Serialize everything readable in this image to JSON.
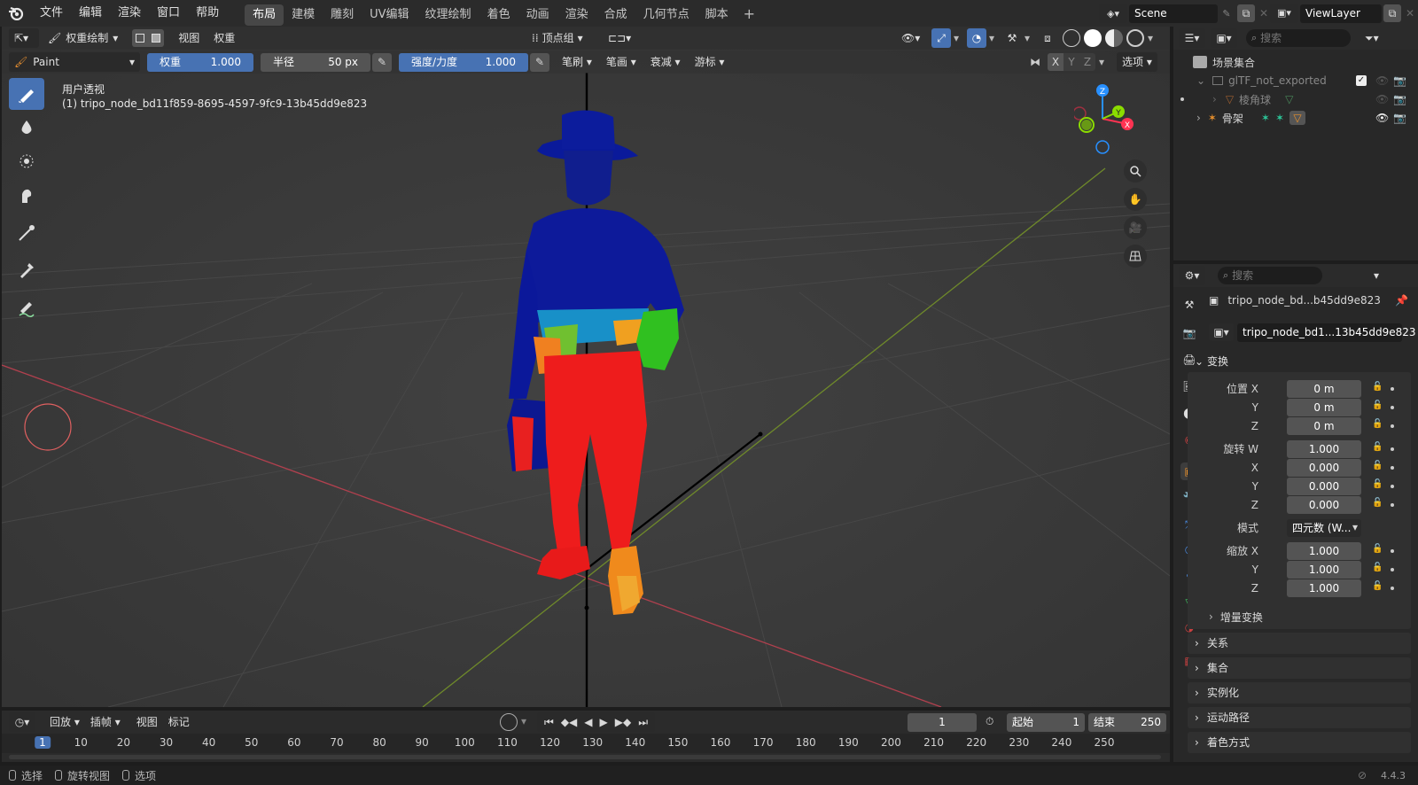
{
  "menu": {
    "items": [
      "文件",
      "编辑",
      "渲染",
      "窗口",
      "帮助"
    ]
  },
  "workspaces": {
    "tabs": [
      "布局",
      "建模",
      "雕刻",
      "UV编辑",
      "纹理绘制",
      "着色",
      "动画",
      "渲染",
      "合成",
      "几何节点",
      "脚本"
    ],
    "active": 0
  },
  "scene": {
    "name": "Scene",
    "view_layer": "ViewLayer"
  },
  "viewport_header": {
    "mode": "权重绘制",
    "view": "视图",
    "weights": "权重",
    "vertex_group": "顶点组"
  },
  "tool_settings": {
    "brush": "Paint",
    "weight_label": "权重",
    "weight_value": "1.000",
    "radius_label": "半径",
    "radius_value": "50 px",
    "strength_label": "强度/力度",
    "strength_value": "1.000",
    "brush_menu": "笔刷",
    "stroke_menu": "笔画",
    "falloff_menu": "衰减",
    "cursor_menu": "游标",
    "mirror": {
      "x": "X",
      "y": "Y",
      "z": "Z"
    },
    "options": "选项"
  },
  "overlay_text": {
    "view_name": "用户透视",
    "object_name": "(1) tripo_node_bd11f859-8695-4597-9fc9-13b45dd9e823"
  },
  "gizmo": {
    "x": "X",
    "y": "Y",
    "z": "Z"
  },
  "outliner": {
    "search_placeholder": "搜索",
    "root": "场景集合",
    "items": [
      {
        "name": "glTF_not_exported",
        "level": 1
      },
      {
        "name": "棱角球",
        "level": 2
      },
      {
        "name": "骨架",
        "level": 1
      }
    ]
  },
  "properties": {
    "search_placeholder": "搜索",
    "object_short": "tripo_node_bd...b45dd9e823",
    "object_field": "tripo_node_bd1...13b45dd9e823",
    "transform_panel": "变换",
    "rows": [
      {
        "label": "位置 X",
        "value": "0 m"
      },
      {
        "label": "Y",
        "value": "0 m"
      },
      {
        "label": "Z",
        "value": "0 m"
      },
      {
        "label": "旋转 W",
        "value": "1.000"
      },
      {
        "label": "X",
        "value": "0.000"
      },
      {
        "label": "Y",
        "value": "0.000"
      },
      {
        "label": "Z",
        "value": "0.000"
      },
      {
        "label": "模式",
        "value": "四元数 (W..."
      },
      {
        "label": "缩放 X",
        "value": "1.000"
      },
      {
        "label": "Y",
        "value": "1.000"
      },
      {
        "label": "Z",
        "value": "1.000"
      }
    ],
    "delta_transform": "增量变换",
    "panels": [
      "关系",
      "集合",
      "实例化",
      "运动路径",
      "着色方式"
    ]
  },
  "timeline": {
    "playback": "回放",
    "keying": "插帧",
    "view": "视图",
    "marker": "标记",
    "current_frame": "1",
    "start_label": "起始",
    "start_value": "1",
    "end_label": "结束",
    "end_value": "250",
    "ruler": [
      "1",
      "10",
      "20",
      "30",
      "40",
      "50",
      "60",
      "70",
      "80",
      "90",
      "100",
      "110",
      "120",
      "130",
      "140",
      "150",
      "160",
      "170",
      "180",
      "190",
      "200",
      "210",
      "220",
      "230",
      "240",
      "250"
    ]
  },
  "status": {
    "select": "选择",
    "rotate": "旋转视图",
    "options": "选项",
    "version": "4.4.3"
  },
  "colors": {
    "accent": "#4772b3",
    "x_axis": "#ff3352",
    "y_axis": "#8bdc00",
    "z_axis": "#2890ff"
  }
}
